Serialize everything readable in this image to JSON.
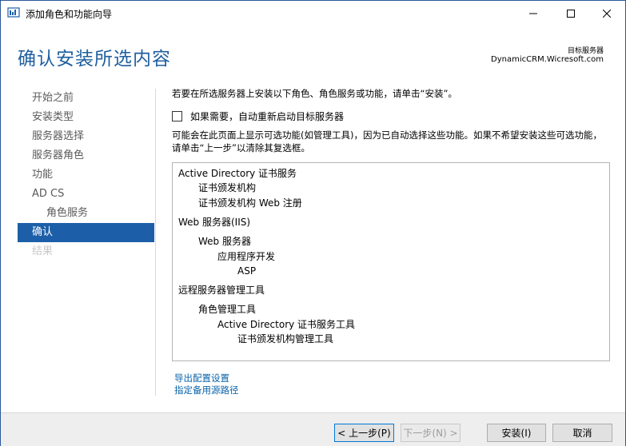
{
  "window": {
    "title": "添加角色和功能向导"
  },
  "header": {
    "page_title": "确认安装所选内容",
    "target_label": "目标服务器",
    "target_server": "DynamicCRM.Wicresoft.com"
  },
  "nav": {
    "items": [
      {
        "label": "开始之前",
        "state": "normal"
      },
      {
        "label": "安装类型",
        "state": "normal"
      },
      {
        "label": "服务器选择",
        "state": "normal"
      },
      {
        "label": "服务器角色",
        "state": "normal"
      },
      {
        "label": "功能",
        "state": "normal"
      },
      {
        "label": "AD CS",
        "state": "normal"
      },
      {
        "label": "角色服务",
        "state": "sub"
      },
      {
        "label": "确认",
        "state": "active"
      },
      {
        "label": "结果",
        "state": "disabled"
      }
    ]
  },
  "main": {
    "intro": "若要在所选服务器上安装以下角色、角色服务或功能，请单击“安装”。",
    "restart_label": "如果需要，自动重新启动目标服务器",
    "restart_checked": false,
    "notice": "可能会在此页面上显示可选功能(如管理工具)，因为已自动选择这些功能。如果不希望安装这些可选功能，请单击“上一步”以清除其复选框。",
    "tree": [
      {
        "label": "Active Directory 证书服务",
        "level": 0
      },
      {
        "label": "证书颁发机构",
        "level": 1
      },
      {
        "label": "证书颁发机构 Web 注册",
        "level": 1
      },
      {
        "label": "Web 服务器(IIS)",
        "level": 0
      },
      {
        "label": "Web 服务器",
        "level": 1
      },
      {
        "label": "应用程序开发",
        "level": 2
      },
      {
        "label": "ASP",
        "level": 3
      },
      {
        "label": "远程服务器管理工具",
        "level": 0
      },
      {
        "label": "角色管理工具",
        "level": 1
      },
      {
        "label": "Active Directory 证书服务工具",
        "level": 2
      },
      {
        "label": "证书颁发机构管理工具",
        "level": 3
      }
    ],
    "links": {
      "export": "导出配置设置",
      "alt_source": "指定备用源路径"
    }
  },
  "footer": {
    "prev": "< 上一步(P)",
    "next": "下一步(N) >",
    "install": "安装(I)",
    "cancel": "取消"
  },
  "colors": {
    "accent": "#1c5fa8",
    "title": "#1f5f9f",
    "link": "#0b63a8",
    "disabled": "#c8c8c8"
  }
}
